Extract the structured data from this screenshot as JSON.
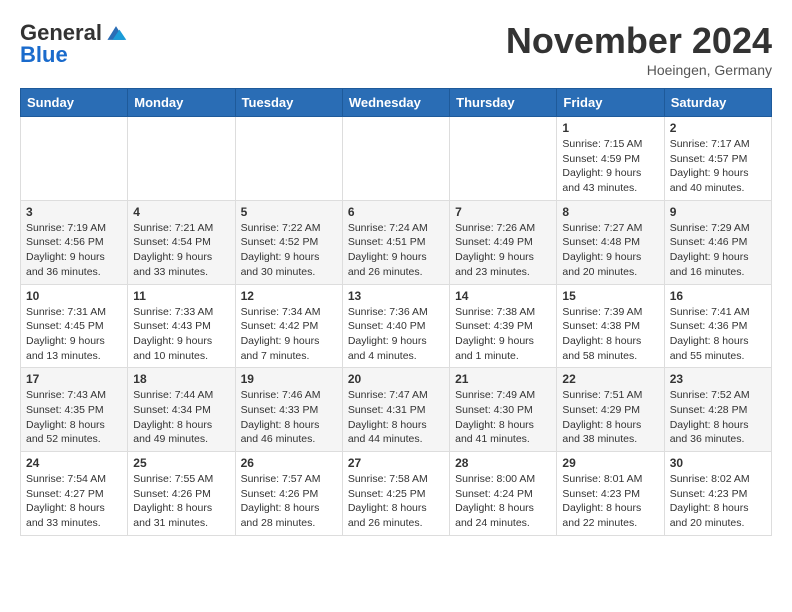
{
  "logo": {
    "general": "General",
    "blue": "Blue"
  },
  "title": {
    "month_year": "November 2024",
    "location": "Hoeingen, Germany"
  },
  "weekdays": [
    "Sunday",
    "Monday",
    "Tuesday",
    "Wednesday",
    "Thursday",
    "Friday",
    "Saturday"
  ],
  "weeks": [
    [
      {
        "day": "",
        "info": ""
      },
      {
        "day": "",
        "info": ""
      },
      {
        "day": "",
        "info": ""
      },
      {
        "day": "",
        "info": ""
      },
      {
        "day": "",
        "info": ""
      },
      {
        "day": "1",
        "info": "Sunrise: 7:15 AM\nSunset: 4:59 PM\nDaylight: 9 hours\nand 43 minutes."
      },
      {
        "day": "2",
        "info": "Sunrise: 7:17 AM\nSunset: 4:57 PM\nDaylight: 9 hours\nand 40 minutes."
      }
    ],
    [
      {
        "day": "3",
        "info": "Sunrise: 7:19 AM\nSunset: 4:56 PM\nDaylight: 9 hours\nand 36 minutes."
      },
      {
        "day": "4",
        "info": "Sunrise: 7:21 AM\nSunset: 4:54 PM\nDaylight: 9 hours\nand 33 minutes."
      },
      {
        "day": "5",
        "info": "Sunrise: 7:22 AM\nSunset: 4:52 PM\nDaylight: 9 hours\nand 30 minutes."
      },
      {
        "day": "6",
        "info": "Sunrise: 7:24 AM\nSunset: 4:51 PM\nDaylight: 9 hours\nand 26 minutes."
      },
      {
        "day": "7",
        "info": "Sunrise: 7:26 AM\nSunset: 4:49 PM\nDaylight: 9 hours\nand 23 minutes."
      },
      {
        "day": "8",
        "info": "Sunrise: 7:27 AM\nSunset: 4:48 PM\nDaylight: 9 hours\nand 20 minutes."
      },
      {
        "day": "9",
        "info": "Sunrise: 7:29 AM\nSunset: 4:46 PM\nDaylight: 9 hours\nand 16 minutes."
      }
    ],
    [
      {
        "day": "10",
        "info": "Sunrise: 7:31 AM\nSunset: 4:45 PM\nDaylight: 9 hours\nand 13 minutes."
      },
      {
        "day": "11",
        "info": "Sunrise: 7:33 AM\nSunset: 4:43 PM\nDaylight: 9 hours\nand 10 minutes."
      },
      {
        "day": "12",
        "info": "Sunrise: 7:34 AM\nSunset: 4:42 PM\nDaylight: 9 hours\nand 7 minutes."
      },
      {
        "day": "13",
        "info": "Sunrise: 7:36 AM\nSunset: 4:40 PM\nDaylight: 9 hours\nand 4 minutes."
      },
      {
        "day": "14",
        "info": "Sunrise: 7:38 AM\nSunset: 4:39 PM\nDaylight: 9 hours\nand 1 minute."
      },
      {
        "day": "15",
        "info": "Sunrise: 7:39 AM\nSunset: 4:38 PM\nDaylight: 8 hours\nand 58 minutes."
      },
      {
        "day": "16",
        "info": "Sunrise: 7:41 AM\nSunset: 4:36 PM\nDaylight: 8 hours\nand 55 minutes."
      }
    ],
    [
      {
        "day": "17",
        "info": "Sunrise: 7:43 AM\nSunset: 4:35 PM\nDaylight: 8 hours\nand 52 minutes."
      },
      {
        "day": "18",
        "info": "Sunrise: 7:44 AM\nSunset: 4:34 PM\nDaylight: 8 hours\nand 49 minutes."
      },
      {
        "day": "19",
        "info": "Sunrise: 7:46 AM\nSunset: 4:33 PM\nDaylight: 8 hours\nand 46 minutes."
      },
      {
        "day": "20",
        "info": "Sunrise: 7:47 AM\nSunset: 4:31 PM\nDaylight: 8 hours\nand 44 minutes."
      },
      {
        "day": "21",
        "info": "Sunrise: 7:49 AM\nSunset: 4:30 PM\nDaylight: 8 hours\nand 41 minutes."
      },
      {
        "day": "22",
        "info": "Sunrise: 7:51 AM\nSunset: 4:29 PM\nDaylight: 8 hours\nand 38 minutes."
      },
      {
        "day": "23",
        "info": "Sunrise: 7:52 AM\nSunset: 4:28 PM\nDaylight: 8 hours\nand 36 minutes."
      }
    ],
    [
      {
        "day": "24",
        "info": "Sunrise: 7:54 AM\nSunset: 4:27 PM\nDaylight: 8 hours\nand 33 minutes."
      },
      {
        "day": "25",
        "info": "Sunrise: 7:55 AM\nSunset: 4:26 PM\nDaylight: 8 hours\nand 31 minutes."
      },
      {
        "day": "26",
        "info": "Sunrise: 7:57 AM\nSunset: 4:26 PM\nDaylight: 8 hours\nand 28 minutes."
      },
      {
        "day": "27",
        "info": "Sunrise: 7:58 AM\nSunset: 4:25 PM\nDaylight: 8 hours\nand 26 minutes."
      },
      {
        "day": "28",
        "info": "Sunrise: 8:00 AM\nSunset: 4:24 PM\nDaylight: 8 hours\nand 24 minutes."
      },
      {
        "day": "29",
        "info": "Sunrise: 8:01 AM\nSunset: 4:23 PM\nDaylight: 8 hours\nand 22 minutes."
      },
      {
        "day": "30",
        "info": "Sunrise: 8:02 AM\nSunset: 4:23 PM\nDaylight: 8 hours\nand 20 minutes."
      }
    ]
  ]
}
